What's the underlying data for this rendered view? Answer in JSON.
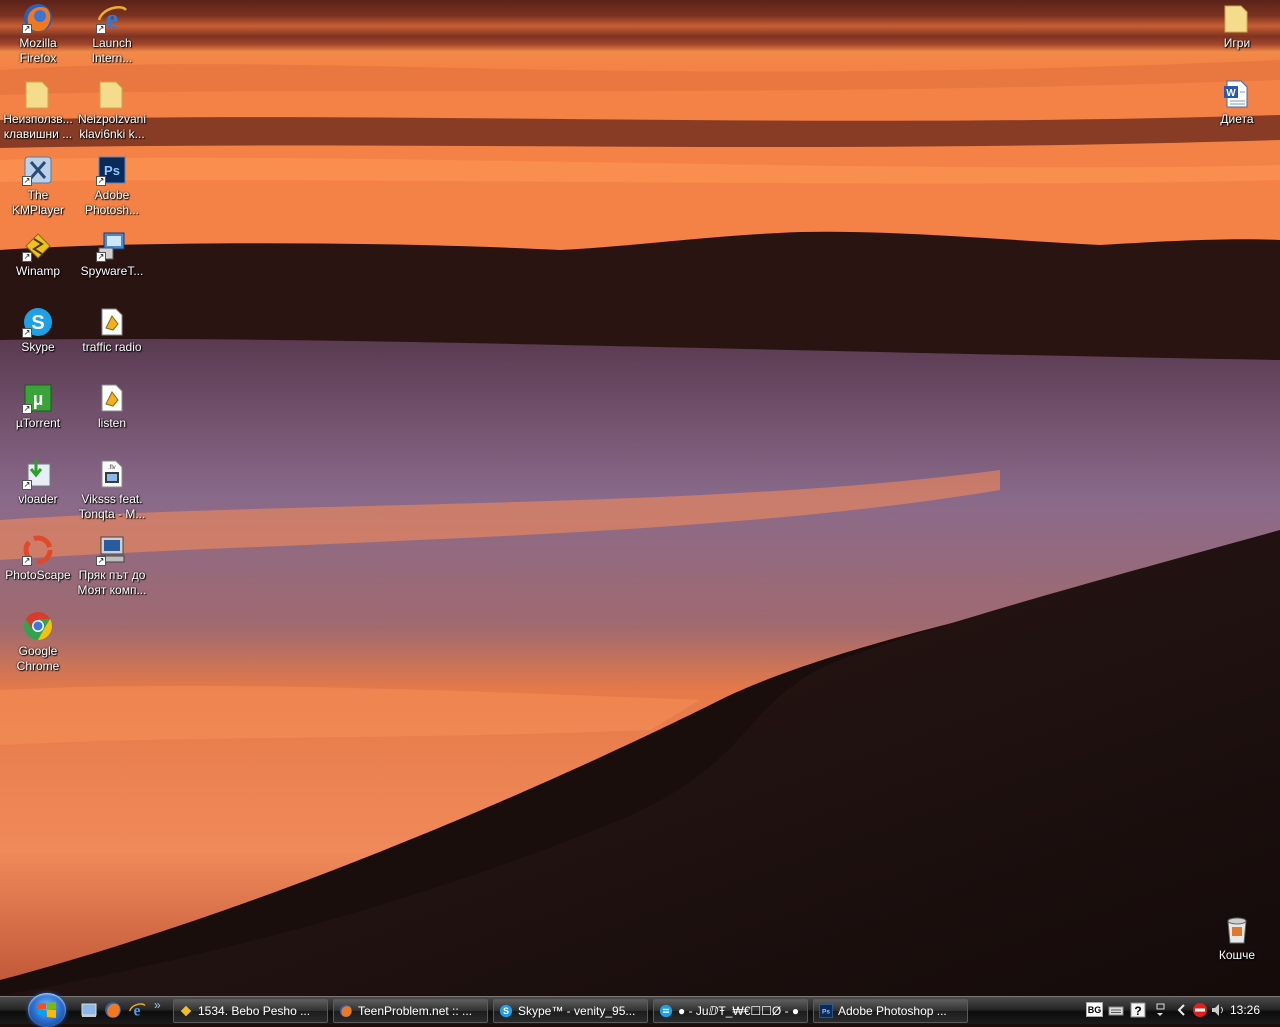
{
  "desktop": {
    "icons": [
      {
        "label": "Mozilla\nFirefox",
        "icon": "firefox-icon",
        "shortcut": true
      },
      {
        "label": "Launch\nIntern...",
        "icon": "internet-explorer-icon",
        "shortcut": true
      },
      {
        "label": "Неизползв...\nклавишни ...",
        "icon": "folder-icon",
        "shortcut": false
      },
      {
        "label": "Neizpolzvani\nklavi6nki k...",
        "icon": "folder-icon",
        "shortcut": false
      },
      {
        "label": "The\nKMPlayer",
        "icon": "kmplayer-icon",
        "shortcut": true
      },
      {
        "label": "Adobe\nPhotosh...",
        "icon": "photoshop-icon",
        "shortcut": true
      },
      {
        "label": "Winamp",
        "icon": "winamp-icon",
        "shortcut": true
      },
      {
        "label": "SpywareT...",
        "icon": "spywareterminator-icon",
        "shortcut": true
      },
      {
        "label": "Skype",
        "icon": "skype-icon",
        "shortcut": true
      },
      {
        "label": "traffic radio",
        "icon": "playlist-file-icon",
        "shortcut": false
      },
      {
        "label": "µTorrent",
        "icon": "utorrent-icon",
        "shortcut": true
      },
      {
        "label": "listen",
        "icon": "playlist-file-icon",
        "shortcut": false
      },
      {
        "label": "vloader",
        "icon": "vloader-icon",
        "shortcut": true
      },
      {
        "label": "Viksss feat.\nTonqta - M...",
        "icon": "flv-video-file-icon",
        "shortcut": false
      },
      {
        "label": "PhotoScape",
        "icon": "photoscape-icon",
        "shortcut": true
      },
      {
        "label": "Пряк път до\nМоят комп...",
        "icon": "my-computer-icon",
        "shortcut": true
      },
      {
        "label": "Google\nChrome",
        "icon": "chrome-icon",
        "shortcut": false
      },
      {
        "label": "Игри",
        "icon": "folder-icon",
        "shortcut": false
      },
      {
        "label": "Диета",
        "icon": "word-document-icon",
        "shortcut": false
      },
      {
        "label": "Кошче",
        "icon": "recycle-bin-icon",
        "shortcut": false
      }
    ]
  },
  "taskbar": {
    "quick_launch": [
      "show-desktop-icon",
      "firefox-icon",
      "internet-explorer-icon"
    ],
    "quick_launch_more": "»",
    "tasks": [
      {
        "label": "1534. Bebo Pesho ...",
        "icon": "winamp-icon"
      },
      {
        "label": "TeenProblem.net :: ...",
        "icon": "firefox-icon"
      },
      {
        "label": "Skype™ - venity_95...",
        "icon": "skype-icon"
      },
      {
        "label": "● - JuⅅŦ_₩€☐☐Ø - ●",
        "icon": "skype-chat-icon"
      },
      {
        "label": "Adobe Photoshop ...",
        "icon": "photoshop-icon"
      }
    ],
    "tray": {
      "language": "BG",
      "clock": "13:26"
    }
  },
  "colors": {
    "taskbar_top": "#4a4a4a",
    "taskbar_bottom": "#0c0c0c",
    "start_orb": "#2a6fd1",
    "sunset_orange": "#f27a3c",
    "sky_dark": "#6b2a1c"
  }
}
